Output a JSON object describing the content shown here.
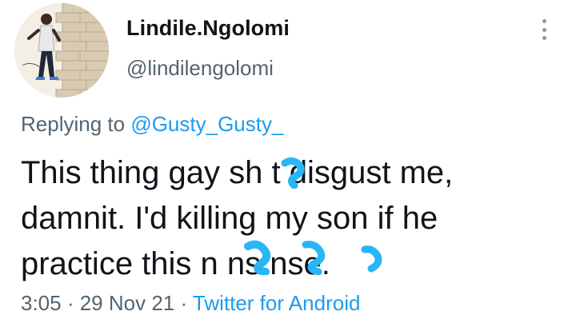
{
  "author": {
    "display_name": "Lindile.Ngolomi",
    "handle": "@lindilengolomi"
  },
  "reply": {
    "prefix": "Replying to ",
    "mention": "@Gusty_Gusty_"
  },
  "tweet": {
    "line1": "This thing gay sh t disgust me,",
    "line2": "damnit. I'd killing my son if he",
    "line3": "practice this n ns nse."
  },
  "meta": {
    "time": "3:05",
    "sep1": " · ",
    "date": "29 Nov 21",
    "sep2": " · ",
    "source": "Twitter for Android"
  },
  "icons": {
    "more": "vertical-ellipsis-icon"
  },
  "colors": {
    "text": "#0f1419",
    "secondary": "#536471",
    "link": "#1d9bf0",
    "censor_scribble": "#29b6f6"
  }
}
